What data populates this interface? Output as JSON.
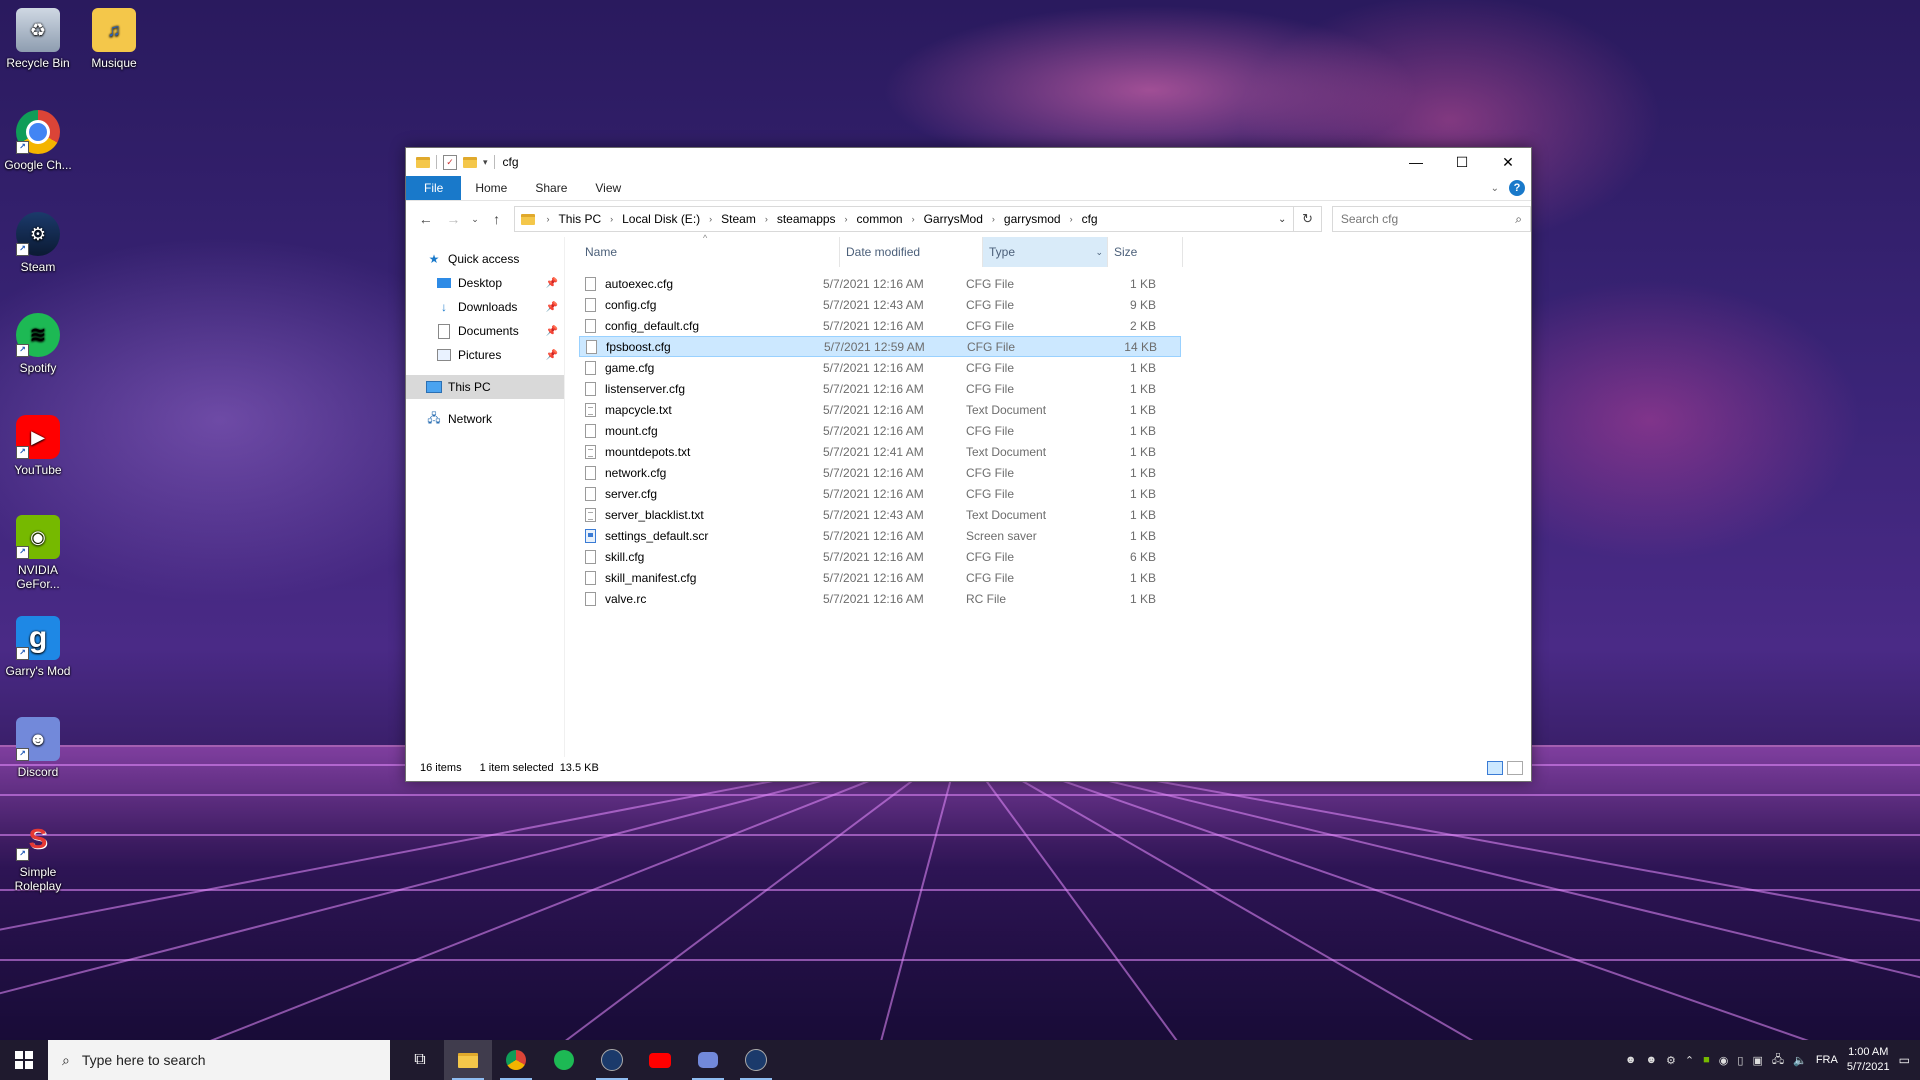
{
  "desktop": {
    "icons": [
      {
        "label": "Recycle Bin",
        "icon": "recycle-bin-icon"
      },
      {
        "label": "Musique",
        "icon": "music-folder-icon"
      },
      {
        "label": "Google Ch...",
        "icon": "chrome-icon"
      },
      {
        "label": "Steam",
        "icon": "steam-icon"
      },
      {
        "label": "Spotify",
        "icon": "spotify-icon"
      },
      {
        "label": "YouTube",
        "icon": "youtube-icon"
      },
      {
        "label": "NVIDIA GeFor...",
        "icon": "nvidia-icon"
      },
      {
        "label": "Garry's Mod",
        "icon": "garrys-mod-icon"
      },
      {
        "label": "Discord",
        "icon": "discord-icon"
      },
      {
        "label": "Simple Roleplay",
        "icon": "simple-roleplay-icon"
      }
    ]
  },
  "explorer": {
    "title": "cfg",
    "ribbon_tabs": {
      "file": "File",
      "home": "Home",
      "share": "Share",
      "view": "View"
    },
    "help_label": "?",
    "breadcrumb": [
      "This PC",
      "Local Disk (E:)",
      "Steam",
      "steamapps",
      "common",
      "GarrysMod",
      "garrysmod",
      "cfg"
    ],
    "search_placeholder": "Search cfg",
    "nav": {
      "quick_access": "Quick access",
      "desktop": "Desktop",
      "downloads": "Downloads",
      "documents": "Documents",
      "pictures": "Pictures",
      "this_pc": "This PC",
      "network": "Network"
    },
    "columns": {
      "name": "Name",
      "date": "Date modified",
      "type": "Type",
      "size": "Size"
    },
    "files": [
      {
        "name": "autoexec.cfg",
        "date": "5/7/2021 12:16 AM",
        "type": "CFG File",
        "size": "1 KB"
      },
      {
        "name": "config.cfg",
        "date": "5/7/2021 12:43 AM",
        "type": "CFG File",
        "size": "9 KB"
      },
      {
        "name": "config_default.cfg",
        "date": "5/7/2021 12:16 AM",
        "type": "CFG File",
        "size": "2 KB"
      },
      {
        "name": "fpsboost.cfg",
        "date": "5/7/2021 12:59 AM",
        "type": "CFG File",
        "size": "14 KB"
      },
      {
        "name": "game.cfg",
        "date": "5/7/2021 12:16 AM",
        "type": "CFG File",
        "size": "1 KB"
      },
      {
        "name": "listenserver.cfg",
        "date": "5/7/2021 12:16 AM",
        "type": "CFG File",
        "size": "1 KB"
      },
      {
        "name": "mapcycle.txt",
        "date": "5/7/2021 12:16 AM",
        "type": "Text Document",
        "size": "1 KB"
      },
      {
        "name": "mount.cfg",
        "date": "5/7/2021 12:16 AM",
        "type": "CFG File",
        "size": "1 KB"
      },
      {
        "name": "mountdepots.txt",
        "date": "5/7/2021 12:41 AM",
        "type": "Text Document",
        "size": "1 KB"
      },
      {
        "name": "network.cfg",
        "date": "5/7/2021 12:16 AM",
        "type": "CFG File",
        "size": "1 KB"
      },
      {
        "name": "server.cfg",
        "date": "5/7/2021 12:16 AM",
        "type": "CFG File",
        "size": "1 KB"
      },
      {
        "name": "server_blacklist.txt",
        "date": "5/7/2021 12:43 AM",
        "type": "Text Document",
        "size": "1 KB"
      },
      {
        "name": "settings_default.scr",
        "date": "5/7/2021 12:16 AM",
        "type": "Screen saver",
        "size": "1 KB"
      },
      {
        "name": "skill.cfg",
        "date": "5/7/2021 12:16 AM",
        "type": "CFG File",
        "size": "6 KB"
      },
      {
        "name": "skill_manifest.cfg",
        "date": "5/7/2021 12:16 AM",
        "type": "CFG File",
        "size": "1 KB"
      },
      {
        "name": "valve.rc",
        "date": "5/7/2021 12:16 AM",
        "type": "RC File",
        "size": "1 KB"
      }
    ],
    "selected_file": "fpsboost.cfg",
    "status": {
      "count": "16 items",
      "selection": "1 item selected",
      "size": "13.5 KB"
    }
  },
  "taskbar": {
    "search_placeholder": "Type here to search",
    "apps": [
      "task-view-icon",
      "file-explorer-icon",
      "chrome-icon",
      "spotify-icon",
      "steam-icon",
      "youtube-icon",
      "discord-icon",
      "steam-icon"
    ],
    "language": "FRA",
    "time": "1:00 AM",
    "date": "5/7/2021"
  },
  "colors": {
    "accent": "#1979ca",
    "selection": "#cce8ff"
  }
}
